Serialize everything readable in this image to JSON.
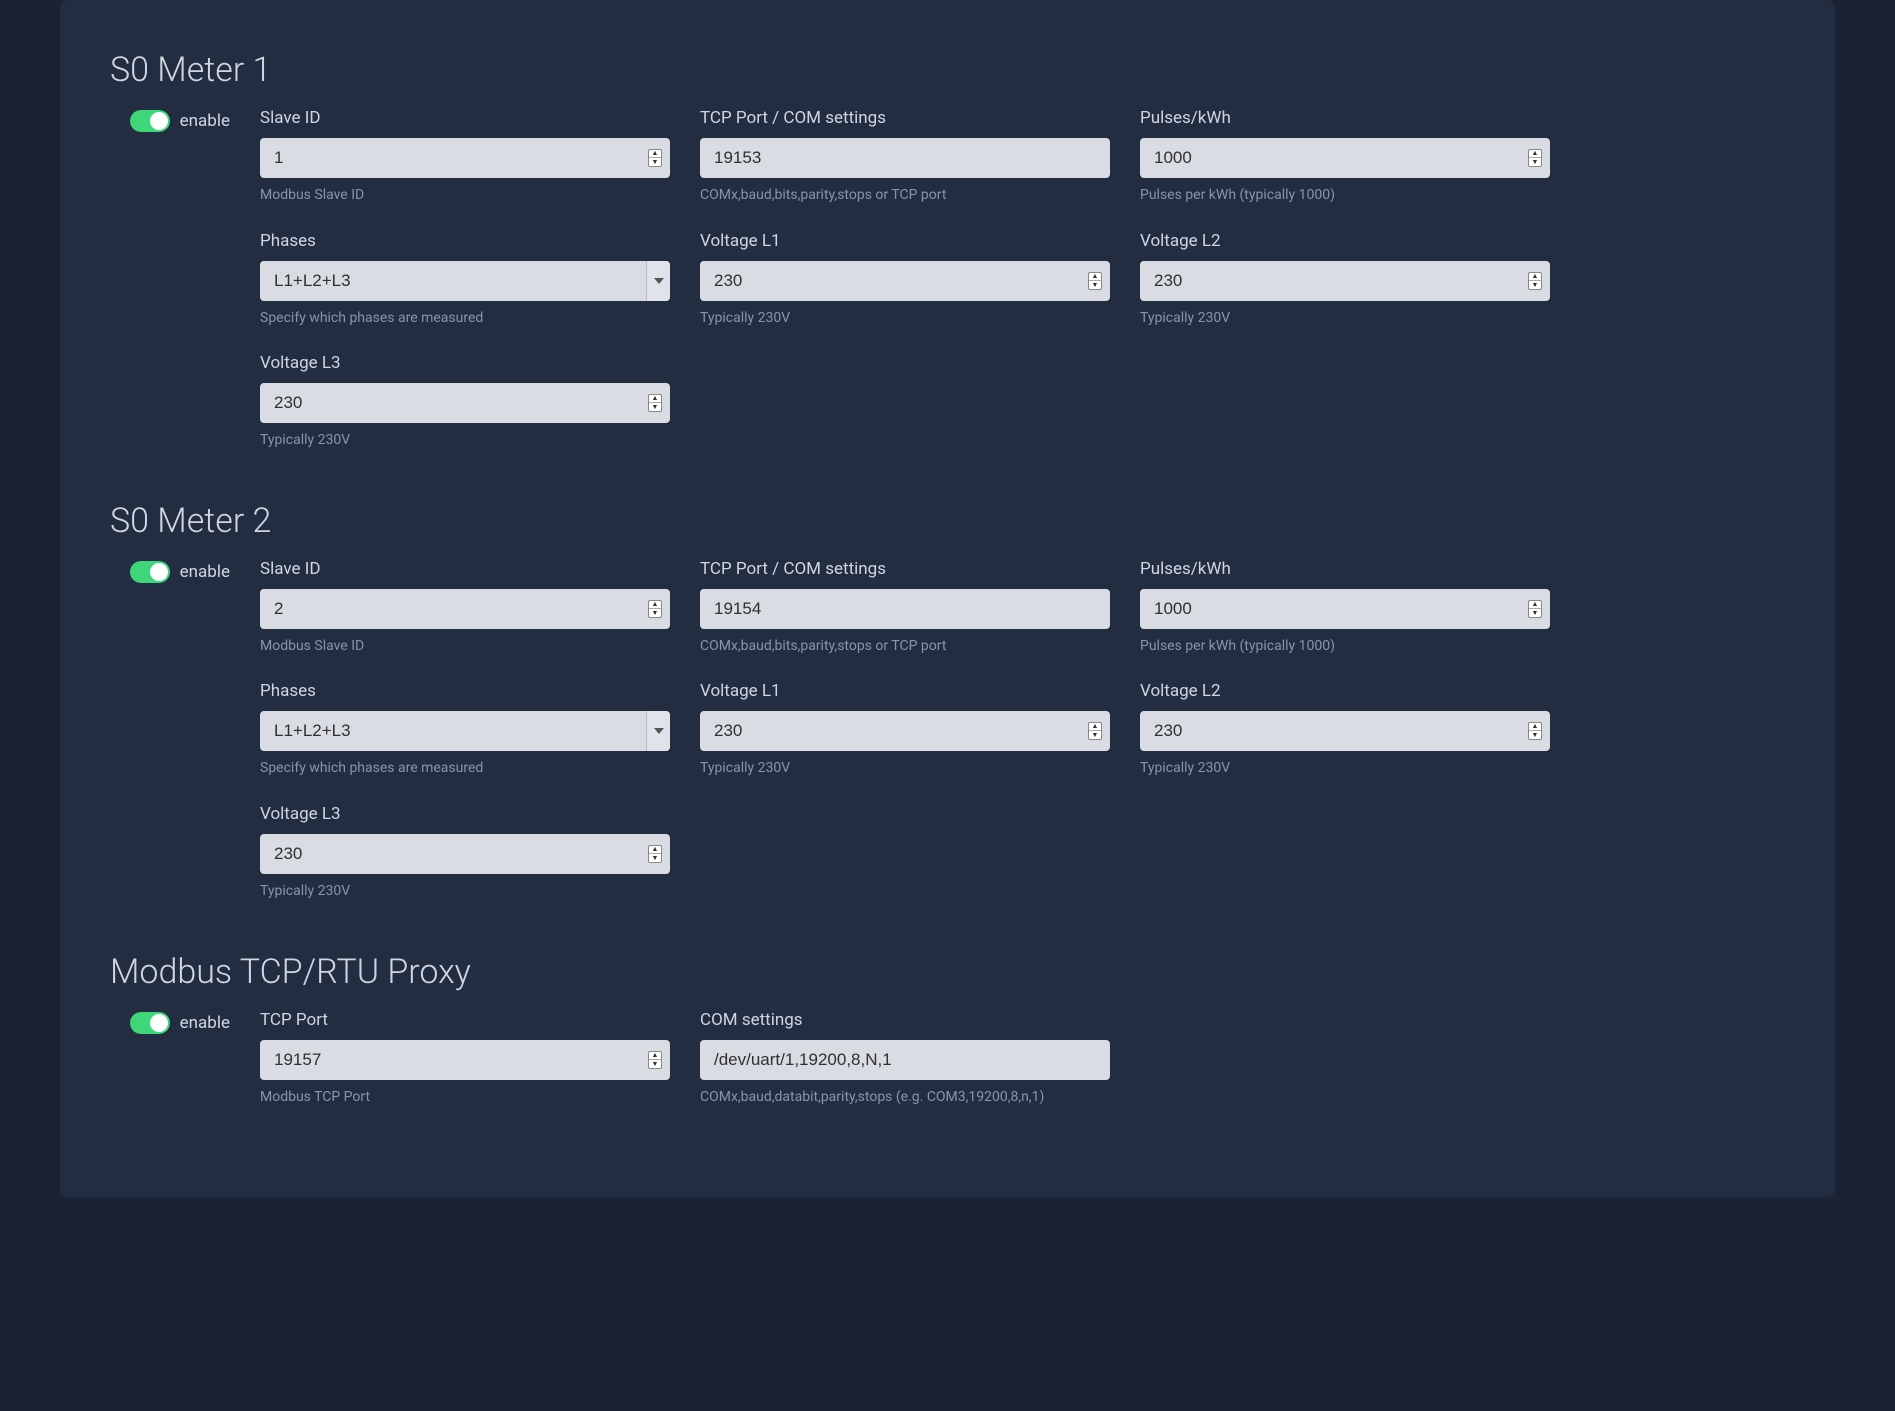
{
  "sections": [
    {
      "title": "S0 Meter 1",
      "enable_label": "enable",
      "fields": {
        "slave_id": {
          "label": "Slave ID",
          "value": "1",
          "help": "Modbus Slave ID",
          "type": "spinner"
        },
        "tcp_port": {
          "label": "TCP Port / COM settings",
          "value": "19153",
          "help": "COMx,baud,bits,parity,stops or TCP port",
          "type": "text"
        },
        "pulses": {
          "label": "Pulses/kWh",
          "value": "1000",
          "help": "Pulses per kWh (typically 1000)",
          "type": "spinner"
        },
        "phases": {
          "label": "Phases",
          "value": "L1+L2+L3",
          "help": "Specify which phases are measured",
          "type": "select"
        },
        "voltage_l1": {
          "label": "Voltage L1",
          "value": "230",
          "help": "Typically 230V",
          "type": "spinner"
        },
        "voltage_l2": {
          "label": "Voltage L2",
          "value": "230",
          "help": "Typically 230V",
          "type": "spinner"
        },
        "voltage_l3": {
          "label": "Voltage L3",
          "value": "230",
          "help": "Typically 230V",
          "type": "spinner"
        }
      }
    },
    {
      "title": "S0 Meter 2",
      "enable_label": "enable",
      "fields": {
        "slave_id": {
          "label": "Slave ID",
          "value": "2",
          "help": "Modbus Slave ID",
          "type": "spinner"
        },
        "tcp_port": {
          "label": "TCP Port / COM settings",
          "value": "19154",
          "help": "COMx,baud,bits,parity,stops or TCP port",
          "type": "text"
        },
        "pulses": {
          "label": "Pulses/kWh",
          "value": "1000",
          "help": "Pulses per kWh (typically 1000)",
          "type": "spinner"
        },
        "phases": {
          "label": "Phases",
          "value": "L1+L2+L3",
          "help": "Specify which phases are measured",
          "type": "select"
        },
        "voltage_l1": {
          "label": "Voltage L1",
          "value": "230",
          "help": "Typically 230V",
          "type": "spinner"
        },
        "voltage_l2": {
          "label": "Voltage L2",
          "value": "230",
          "help": "Typically 230V",
          "type": "spinner"
        },
        "voltage_l3": {
          "label": "Voltage L3",
          "value": "230",
          "help": "Typically 230V",
          "type": "spinner"
        }
      }
    },
    {
      "title": "Modbus TCP/RTU Proxy",
      "enable_label": "enable",
      "fields": {
        "tcp_port": {
          "label": "TCP Port",
          "value": "19157",
          "help": "Modbus TCP Port",
          "type": "spinner"
        },
        "com_settings": {
          "label": "COM settings",
          "value": "/dev/uart/1,19200,8,N,1",
          "help": "COMx,baud,databit,parity,stops (e.g. COM3,19200,8,n,1)",
          "type": "text"
        }
      }
    }
  ]
}
